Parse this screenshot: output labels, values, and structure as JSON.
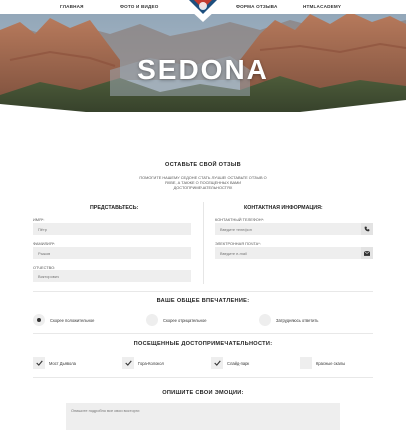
{
  "nav": {
    "items": [
      "ГЛАВНАЯ",
      "ФОТО И ВИДЕО",
      "ФОРМА ОТЗЫВА",
      "HTMLACADEMY"
    ]
  },
  "hero": {
    "title": "SEDONA"
  },
  "form": {
    "title": "ОСТАВЬТЕ СВОЙ ОТЗЫВ",
    "intro": "ПОМОГИТЕ НАШЕМУ СЕДОНЕ СТАТЬ ЛУЧШЕ! ОСТАВЬТЕ ОТЗЫВ О ЯХВЕ, А ТАКЖЕ О ПОСЕЩЕННЫХ ВАМИ ДОСТОПРИМЕЧАТЕЛЬНОСТЯХ",
    "personal": {
      "title": "ПРЕДСТАВЬТЕСЬ:",
      "fields": [
        {
          "label": "ИМЯ*:",
          "placeholder": "Пётр"
        },
        {
          "label": "ФАМИЛИЯ*:",
          "placeholder": "Рыжов"
        },
        {
          "label": "ОТЧЕСТВО:",
          "placeholder": "Викторович"
        }
      ]
    },
    "contact": {
      "title": "КОНТАКТНАЯ ИНФОРМАЦИЯ:",
      "fields": [
        {
          "label": "КОНТАКТНЫЙ ТЕЛЕФОН*:",
          "placeholder": "Введите телефон",
          "icon": "phone-icon"
        },
        {
          "label": "ЭЛЕКТРОННАЯ ПОЧТА*:",
          "placeholder": "Введите e-mail",
          "icon": "envelope-icon"
        }
      ]
    },
    "impression": {
      "title": "ВАШЕ ОБЩЕЕ ВПЕЧАТЛЕНИЕ:",
      "options": [
        {
          "label": "Скорее положительное",
          "selected": true
        },
        {
          "label": "Скорее отрицательное",
          "selected": false
        },
        {
          "label": "Затрудняюсь ответить",
          "selected": false
        }
      ]
    },
    "sights": {
      "title": "ПОСЕЩЕННЫЕ ДОСТОПРИМЕЧАТЕЛЬНОСТИ:",
      "items": [
        {
          "label": "Мост Дьявола",
          "checked": true
        },
        {
          "label": "Гора-Колокол",
          "checked": true
        },
        {
          "label": "Слайд-парк",
          "checked": true
        },
        {
          "label": "Красные скалы",
          "checked": false
        }
      ]
    },
    "emotions": {
      "title": "ОПИШИТЕ СВОИ ЭМОЦИИ:",
      "placeholder": "Опишите подробно все свои восторги"
    }
  },
  "colors": {
    "field_bg": "#eeeeee",
    "text_dark": "#222222",
    "hero_sky": "#7d93a8",
    "rock_red": "#a8644a"
  }
}
